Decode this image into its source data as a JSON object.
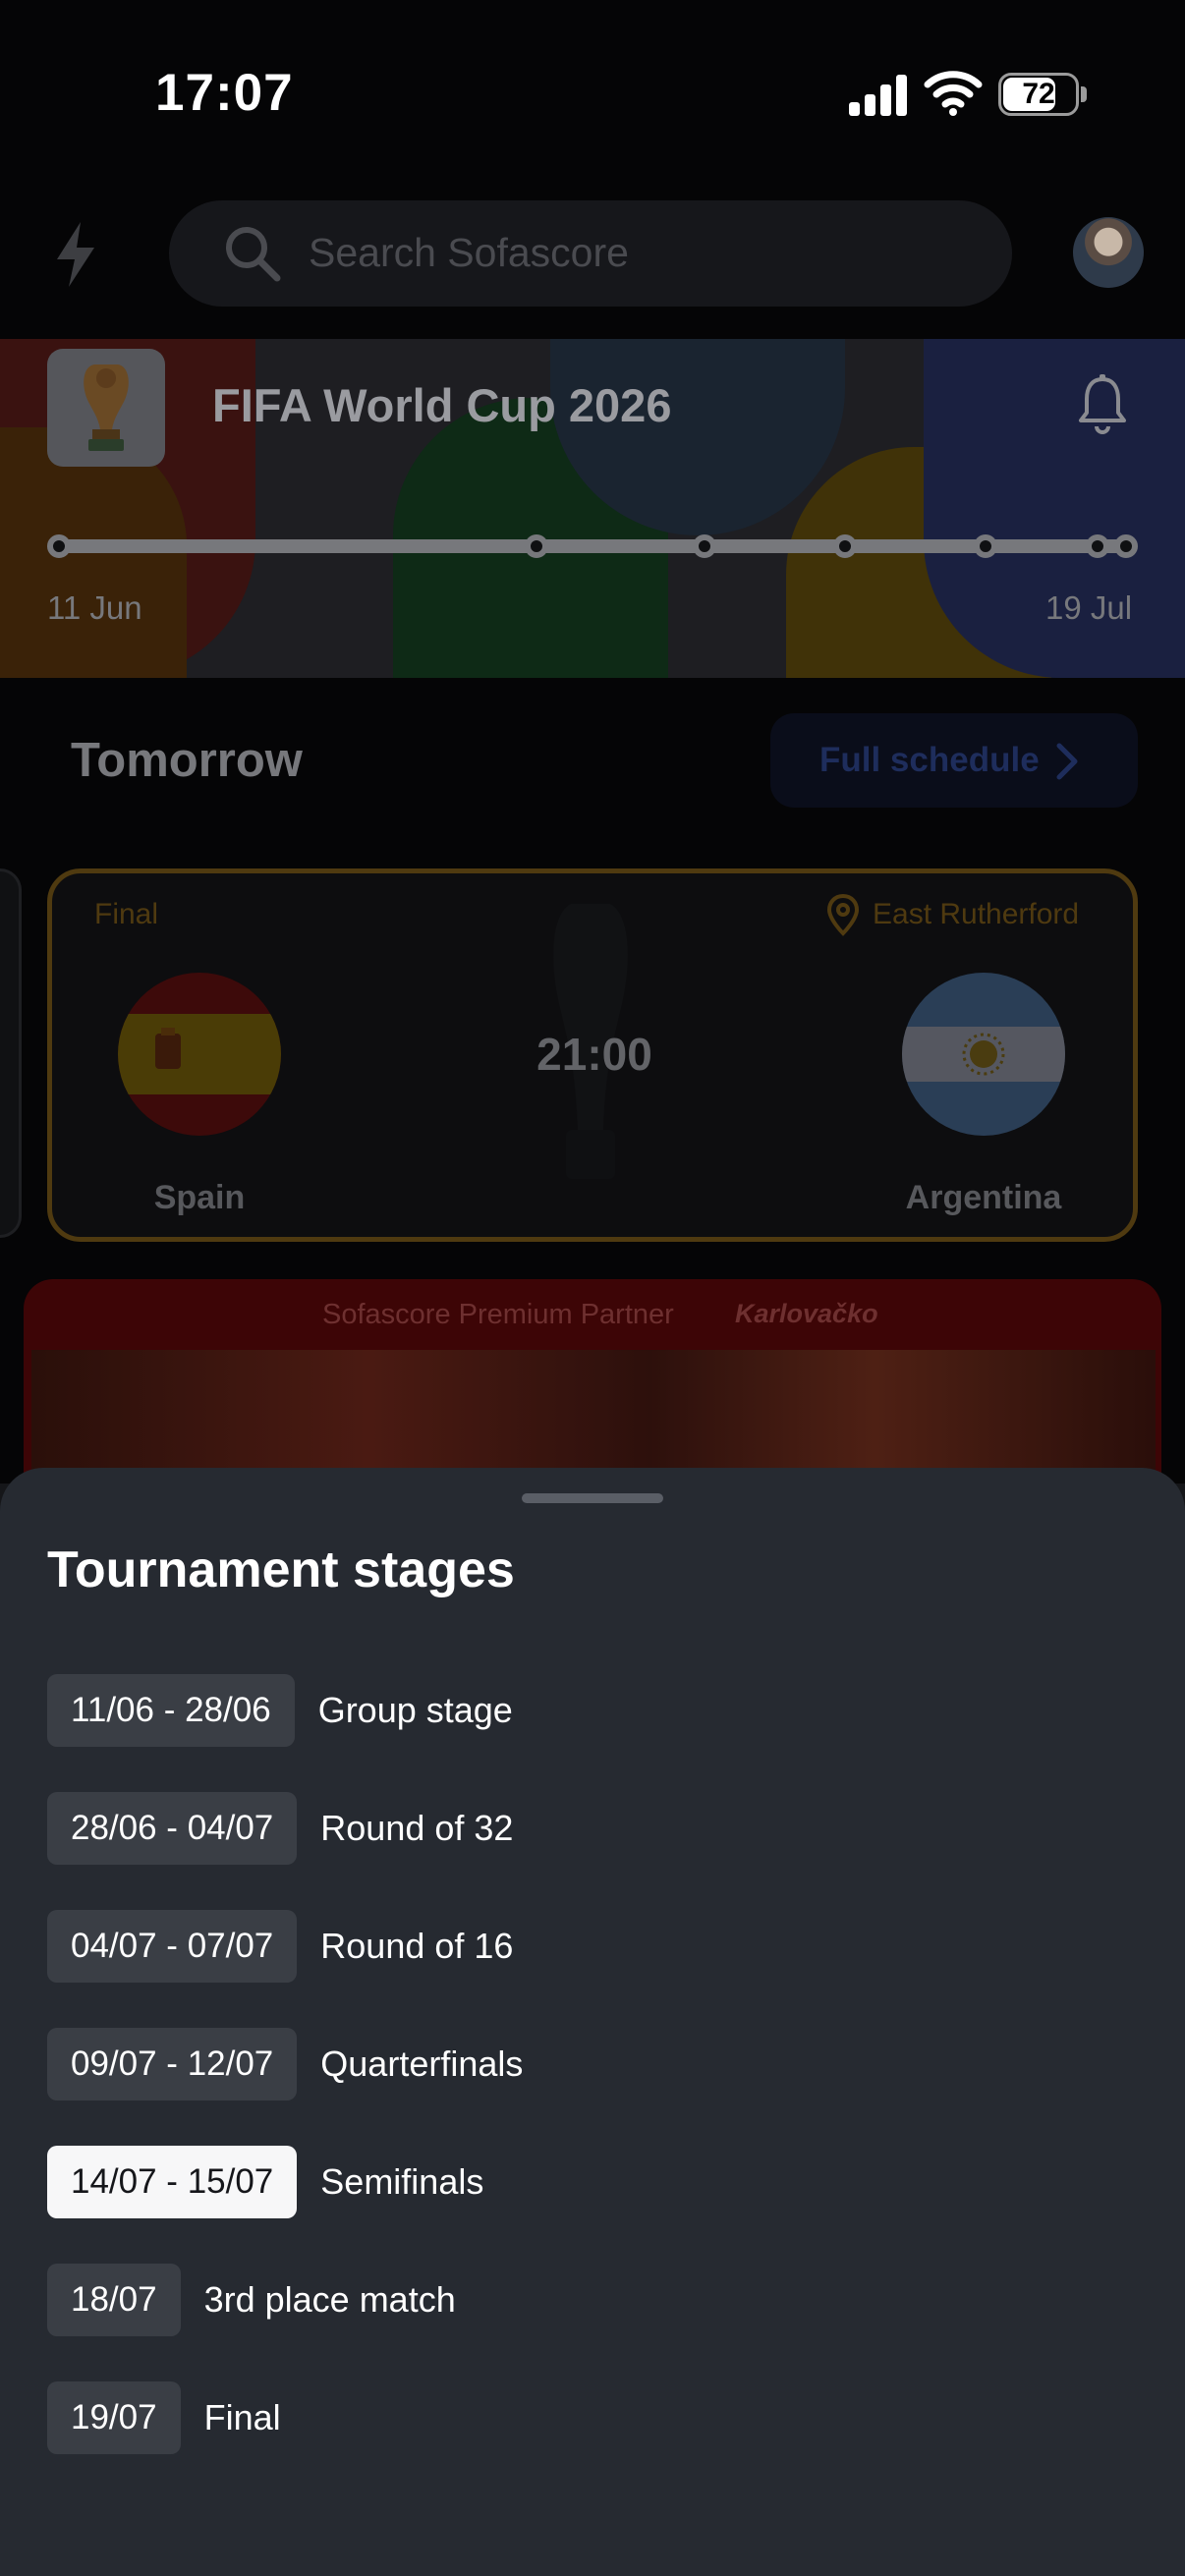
{
  "status_bar": {
    "time": "17:07",
    "battery": "72",
    "battery_level": 0.72
  },
  "header": {
    "search_placeholder": "Search Sofascore"
  },
  "banner": {
    "title": "FIFA World Cup 2026",
    "timeline_start": "11 Jun",
    "timeline_end": "19 Jul",
    "stage_dates": [
      "11/06",
      "28/06",
      "04/07",
      "09/07",
      "14/07",
      "18/07",
      "19/07"
    ]
  },
  "section": {
    "title": "Tomorrow",
    "full_schedule_label": "Full schedule"
  },
  "match": {
    "stage": "Final",
    "venue": "East Rutherford",
    "kickoff": "21:00",
    "home_team": "Spain",
    "away_team": "Argentina"
  },
  "ad": {
    "text": "Sofascore Premium Partner",
    "brand": "Karlovačko"
  },
  "sheet": {
    "title": "Tournament stages",
    "stages": [
      {
        "dates": "11/06 - 28/06",
        "name": "Group stage",
        "active": false
      },
      {
        "dates": "28/06 - 04/07",
        "name": "Round of 32",
        "active": false
      },
      {
        "dates": "04/07 - 07/07",
        "name": "Round of 16",
        "active": false
      },
      {
        "dates": "09/07 - 12/07",
        "name": "Quarterfinals",
        "active": false
      },
      {
        "dates": "14/07 - 15/07",
        "name": "Semifinals",
        "active": true
      },
      {
        "dates": "18/07",
        "name": "3rd place match",
        "active": false
      },
      {
        "dates": "19/07",
        "name": "Final",
        "active": false
      }
    ]
  },
  "colors": {
    "sheet_bg": "#262a31",
    "pill_bg": "#3a3e45",
    "pill_active_bg": "#f7f7f8",
    "card_border": "#4f3a10"
  }
}
